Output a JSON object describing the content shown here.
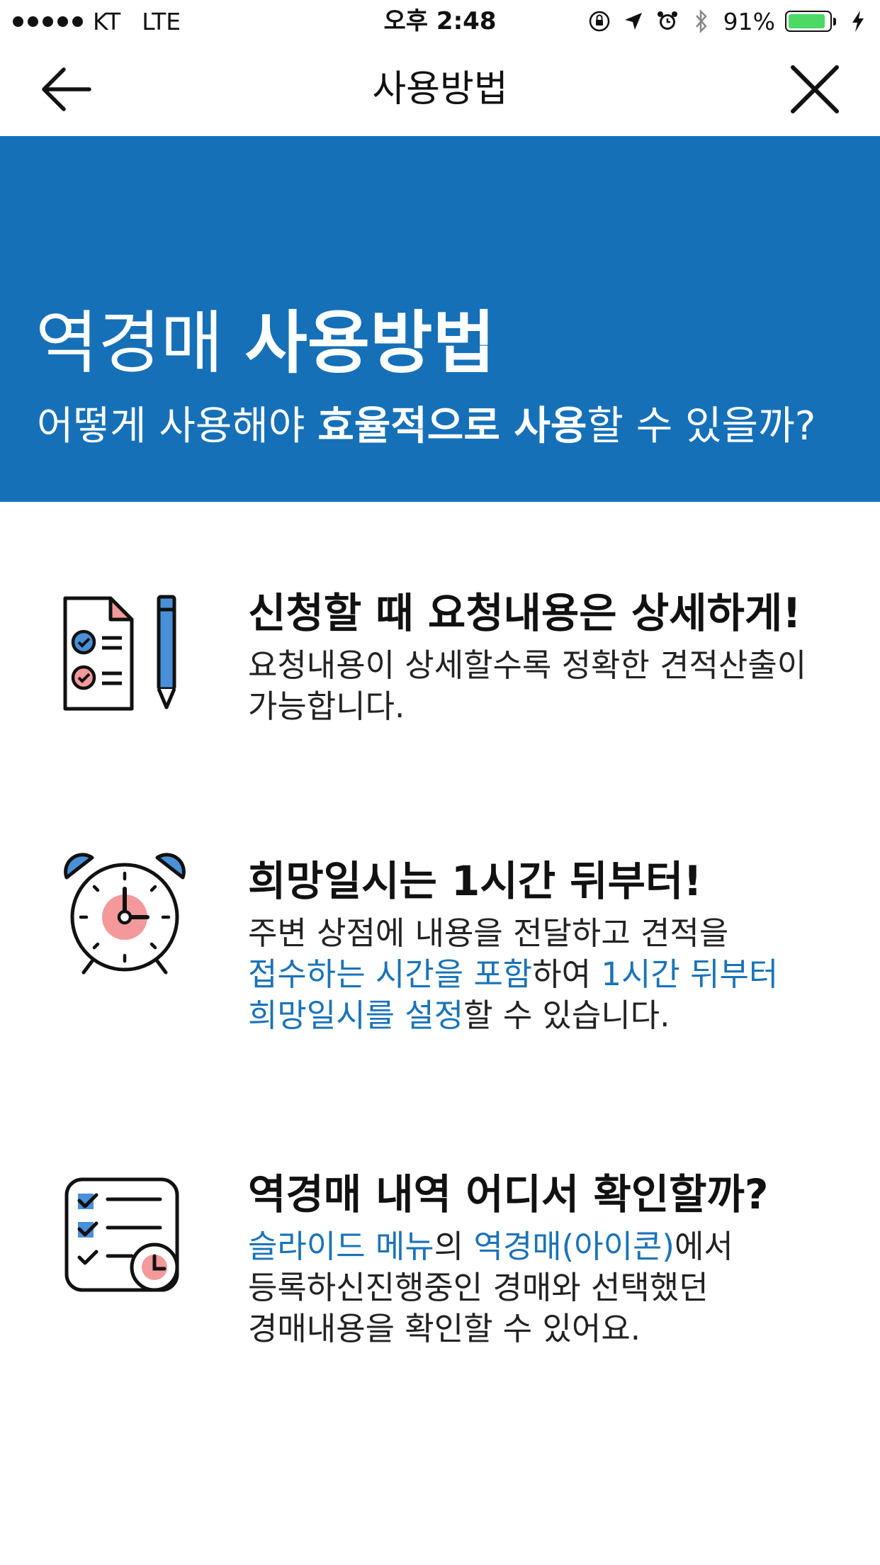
{
  "status_bar": {
    "carrier": "KT",
    "network": "LTE",
    "time": "오후 2:48",
    "battery": "91%",
    "battery_level": 0.91,
    "battery_color": "#4cd964"
  },
  "nav": {
    "title": "사용방법",
    "back_icon": "arrow-left-icon",
    "close_icon": "close-icon"
  },
  "banner": {
    "background": "#1570b8",
    "title_light": "역경매 ",
    "title_bold": "사용방법",
    "subtitle_part1": "어떻게 사용해야 ",
    "subtitle_bold": "효율적으로 사용",
    "subtitle_part2": "할 수 있을까?"
  },
  "sections": [
    {
      "icon": "document-checklist-pencil-icon",
      "heading_light": "신청할 때 ",
      "heading_bold": "요청내용은 상세하게!",
      "body_line1": "요청내용이 상세할수록 정확한 견적산출이",
      "body_line2": "가능합니다."
    },
    {
      "icon": "alarm-clock-icon",
      "heading_light": "희망일시는 ",
      "heading_bold": "1시간 뒤부터!",
      "body_line1": "주변 상점에 내용을 전달하고 견적을",
      "body_hl1": "접수하는 시간을 포함",
      "body_mid": "하여 ",
      "body_hl2": "1시간 뒤부터",
      "body_hl3": "희망일시를 설정",
      "body_end": "할 수 있습니다."
    },
    {
      "icon": "checklist-clock-icon",
      "heading_light": "역경매 ",
      "heading_bold": "내역 어디서 확인할까?",
      "body_hl1": "슬라이드 메뉴",
      "body_mid1": "의 ",
      "body_hl2": "역경매(아이콘)",
      "body_mid2": "에서",
      "body_line2": "등록하신진행중인 경매와 선택했던",
      "body_line3": "경매내용을 확인할 수 있어요."
    }
  ],
  "colors": {
    "accent": "#1a73b8",
    "icon_blue": "#4a90d9",
    "icon_pink": "#f4999b"
  }
}
